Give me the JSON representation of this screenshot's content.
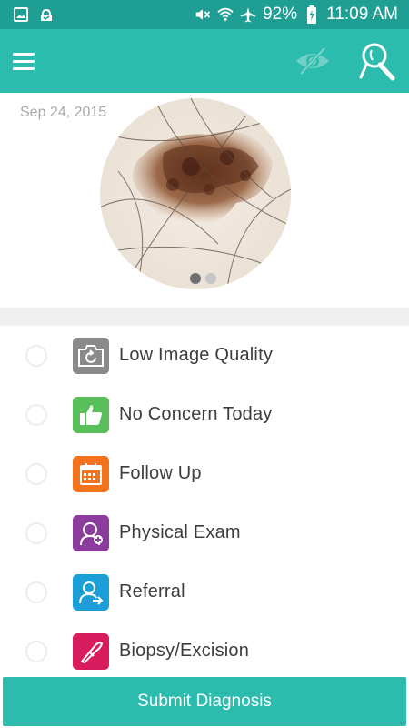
{
  "status_bar": {
    "battery_percent": "92%",
    "time": "11:09 AM",
    "icons": [
      "image-icon",
      "cloud-icon",
      "mute-icon",
      "wifi-icon",
      "airplane-icon",
      "battery-charging-icon"
    ]
  },
  "app_bar": {
    "menu_icon": "hamburger-menu-icon",
    "visibility_icon": "eye-hidden-icon",
    "examine_icon": "magnifier-icon",
    "background_color": "#2cbcae"
  },
  "image_panel": {
    "date": "Sep 24, 2015",
    "pager": {
      "total": 2,
      "active_index": 0
    }
  },
  "options": [
    {
      "label": "Low Image Quality",
      "icon": "camera-refresh-icon",
      "color": "#8a8a8a",
      "selected": false
    },
    {
      "label": "No Concern Today",
      "icon": "thumbs-up-icon",
      "color": "#58bf5a",
      "selected": false
    },
    {
      "label": "Follow Up",
      "icon": "calendar-icon",
      "color": "#f2731c",
      "selected": false
    },
    {
      "label": "Physical Exam",
      "icon": "patient-plus-icon",
      "color": "#8c3c9c",
      "selected": false
    },
    {
      "label": "Referral",
      "icon": "person-arrow-icon",
      "color": "#1c9fd9",
      "selected": false
    },
    {
      "label": "Biopsy/Excision",
      "icon": "scalpel-icon",
      "color": "#d81c5d",
      "selected": false
    }
  ],
  "submit": {
    "label": "Submit Diagnosis"
  }
}
